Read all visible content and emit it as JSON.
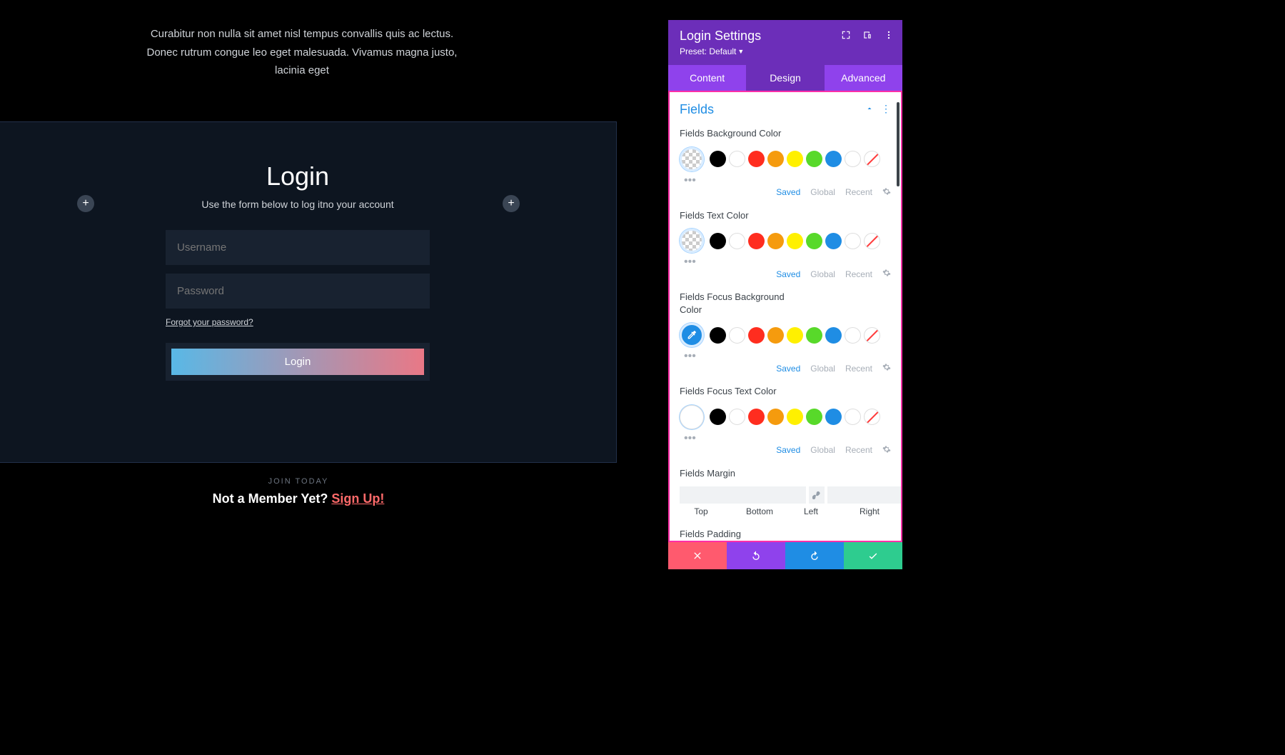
{
  "intro_text": "Curabitur non nulla sit amet nisl tempus convallis quis ac lectus. Donec rutrum congue leo eget malesuada. Vivamus magna justo, lacinia eget",
  "login": {
    "title": "Login",
    "subtitle": "Use the form below to log itno your account",
    "username_placeholder": "Username",
    "password_placeholder": "Password",
    "forgot_text": "Forgot your password?",
    "button": "Login"
  },
  "join": {
    "label": "Join Today",
    "line": "Not a Member Yet? ",
    "signup": "Sign Up!"
  },
  "panel": {
    "title": "Login Settings",
    "preset_label": "Preset: Default",
    "tabs": {
      "content": "Content",
      "design": "Design",
      "advanced": "Advanced"
    },
    "section": "Fields",
    "labels": {
      "bg": "Fields Background Color",
      "text": "Fields Text Color",
      "focus_bg": "Fields Focus Background Color",
      "focus_text": "Fields Focus Text Color",
      "margin": "Fields Margin",
      "padding": "Fields Padding"
    },
    "swatch_links": {
      "saved": "Saved",
      "global": "Global",
      "recent": "Recent"
    },
    "spacing_labels": {
      "top": "Top",
      "bottom": "Bottom",
      "left": "Left",
      "right": "Right"
    },
    "palette": [
      "#000000",
      "#ffffff",
      "#ff2d1f",
      "#f59b0e",
      "#fff000",
      "#58d92a",
      "#1f8de4",
      "#ffffff"
    ]
  }
}
